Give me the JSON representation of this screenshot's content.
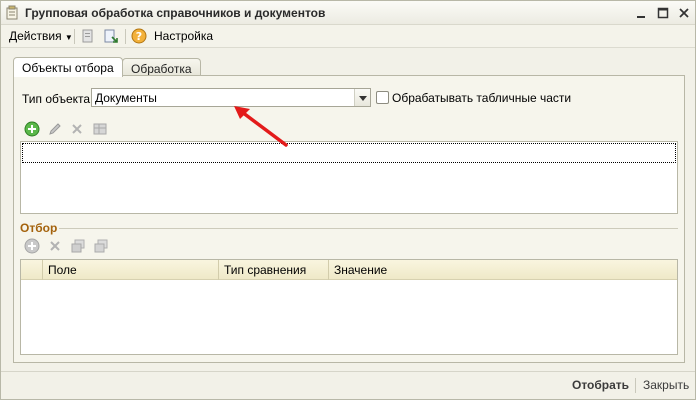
{
  "window": {
    "title": "Групповая обработка справочников и документов"
  },
  "toolbar": {
    "actions_label": "Действия",
    "settings_label": "Настройка"
  },
  "tabs": [
    {
      "label": "Объекты отбора",
      "active": true
    },
    {
      "label": "Обработка",
      "active": false
    }
  ],
  "form": {
    "object_type_label": "Тип объекта:",
    "object_type_value": "Документы",
    "process_tabular_label": "Обрабатывать табличные части",
    "process_tabular_checked": false
  },
  "filter": {
    "group_title": "Отбор",
    "columns": [
      "Поле",
      "Тип сравнения",
      "Значение"
    ]
  },
  "footer": {
    "select_label": "Отобрать",
    "close_label": "Закрыть"
  },
  "colors": {
    "accent_arrow": "#e31b1b",
    "group_title": "#a4620c",
    "grid_header": "#f3eed4"
  }
}
